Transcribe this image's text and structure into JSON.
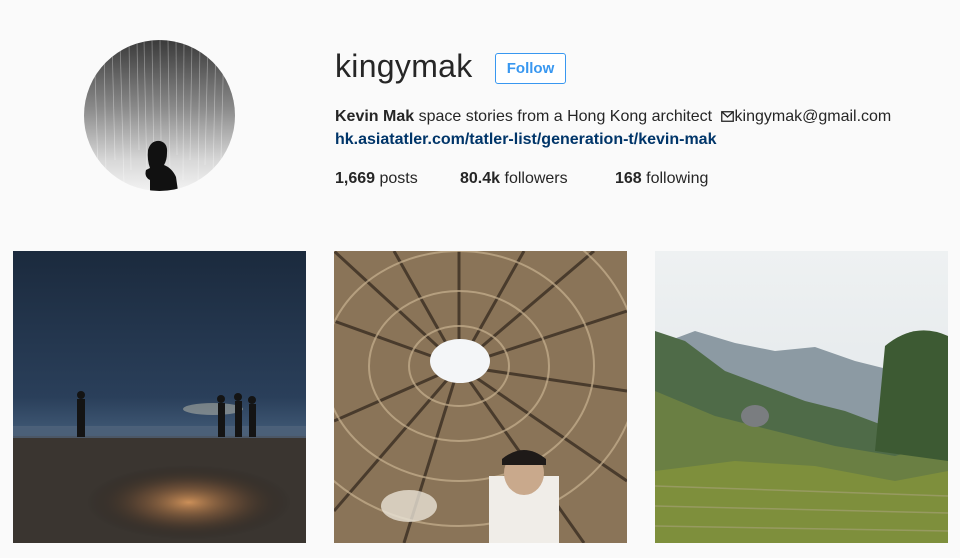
{
  "profile": {
    "username": "kingymak",
    "follow_label": "Follow",
    "full_name": "Kevin Mak",
    "bio_text": " space stories from a Hong Kong architect ",
    "email": "kingymak@gmail.com",
    "link": "hk.asiatatler.com/tatler-list/generation-t/kevin-mak",
    "avatar_icon": "profile-photo-silhouette"
  },
  "stats": {
    "posts_count": "1,669",
    "posts_label": " posts",
    "followers_count": "80.4k",
    "followers_label": " followers",
    "following_count": "168",
    "following_label": " following"
  },
  "colors": {
    "background": "#fafafa",
    "accent": "#3897f0",
    "link": "#003569",
    "text": "#262626"
  }
}
